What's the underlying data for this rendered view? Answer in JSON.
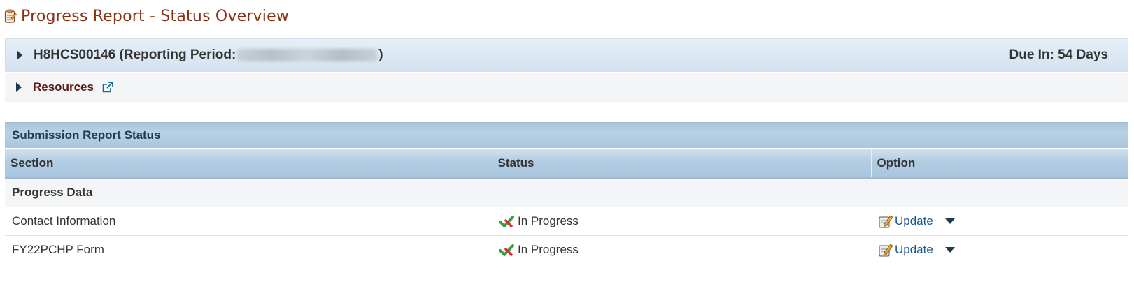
{
  "page": {
    "title": "Progress Report - Status Overview"
  },
  "grant": {
    "title_prefix": "H8HCS00146 (Reporting Period: ",
    "title_suffix": ")",
    "due_label": "Due In: 54 Days"
  },
  "resources": {
    "label": "Resources"
  },
  "status_table": {
    "caption": "Submission Report Status",
    "columns": [
      "Section",
      "Status",
      "Option"
    ],
    "group_label": "Progress Data",
    "rows": [
      {
        "section": "Contact Information",
        "status": "In Progress",
        "option": "Update"
      },
      {
        "section": "FY22PCHP Form",
        "status": "In Progress",
        "option": "Update"
      }
    ]
  },
  "icons": {
    "title": "report-icon",
    "external": "external-link-icon",
    "status": "in-progress-check-icon",
    "option": "edit-icon",
    "dropdown": "caret-down-icon"
  },
  "colors": {
    "title": "#8a2f12",
    "link": "#1a5690",
    "header_bar": "#b2cce2"
  }
}
